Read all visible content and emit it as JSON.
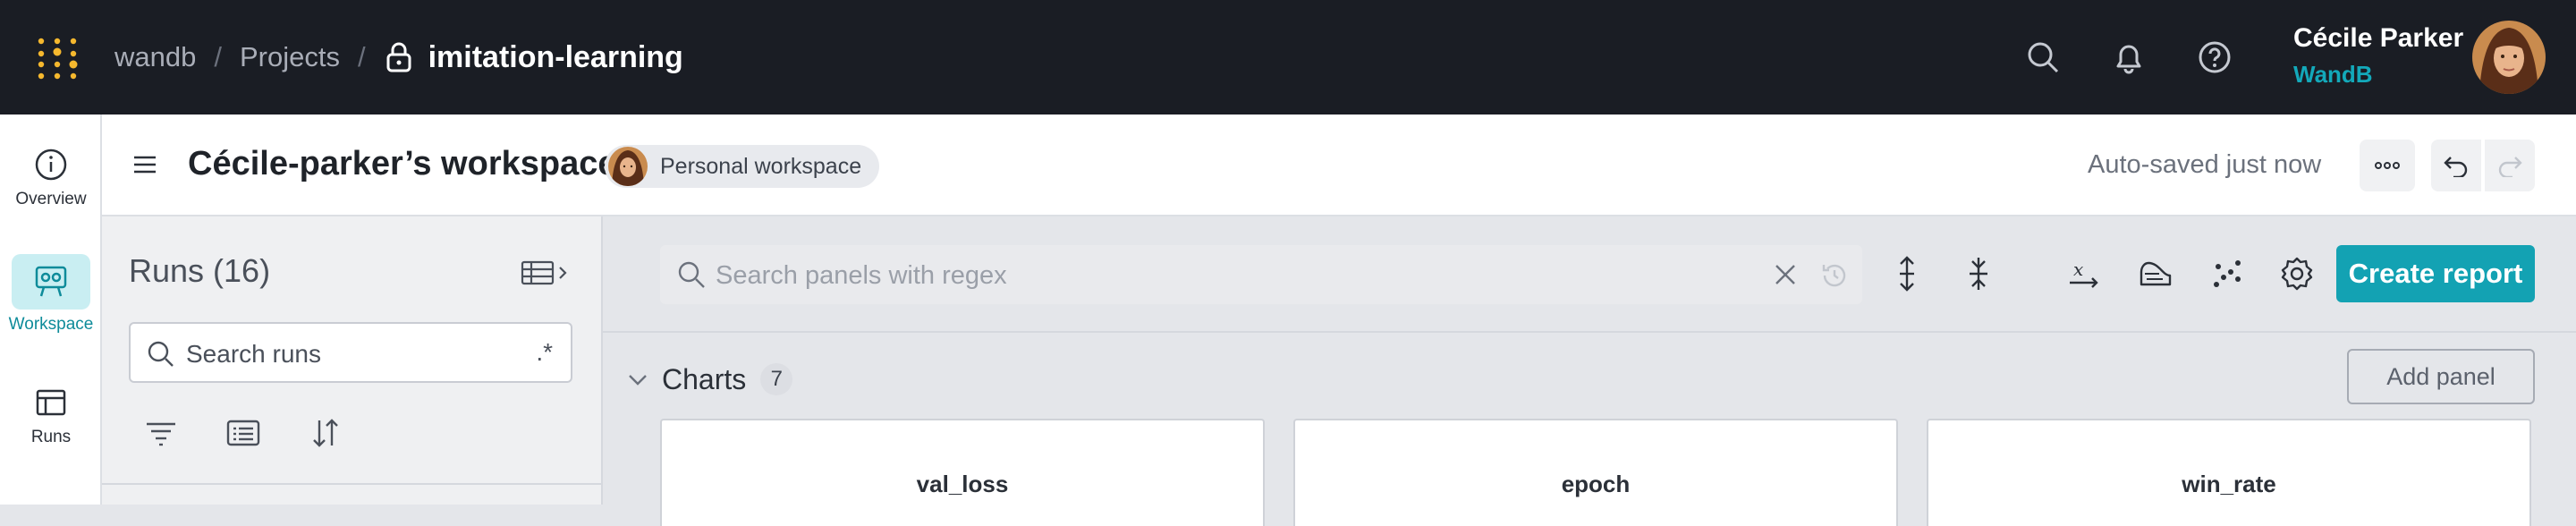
{
  "topbar": {
    "breadcrumb": {
      "org": "wandb",
      "section": "Projects",
      "project": "imitation-learning"
    },
    "user": {
      "name": "Cécile Parker",
      "org": "WandB"
    },
    "icons": [
      "search-icon",
      "bell-icon",
      "help-icon"
    ]
  },
  "leftnav": {
    "items": [
      {
        "label": "Overview",
        "icon": "info-icon",
        "active": false
      },
      {
        "label": "Workspace",
        "icon": "workspace-icon",
        "active": true
      },
      {
        "label": "Runs",
        "icon": "table-icon",
        "active": false
      }
    ]
  },
  "header": {
    "title": "Cécile-parker’s workspace",
    "chip": "Personal workspace",
    "autosave": "Auto-saved just now"
  },
  "runs": {
    "title": "Runs (16)",
    "search_placeholder": "Search runs",
    "regex_label": ".*"
  },
  "main": {
    "search_placeholder": "Search panels with regex",
    "create_report": "Create report",
    "section_label": "Charts",
    "section_count": "7",
    "add_panel": "Add panel",
    "panels": [
      "val_loss",
      "epoch",
      "win_rate"
    ]
  },
  "colors": {
    "accent": "#13a2b3",
    "topbar": "#1a1d24",
    "logo": "#f5b82e"
  }
}
